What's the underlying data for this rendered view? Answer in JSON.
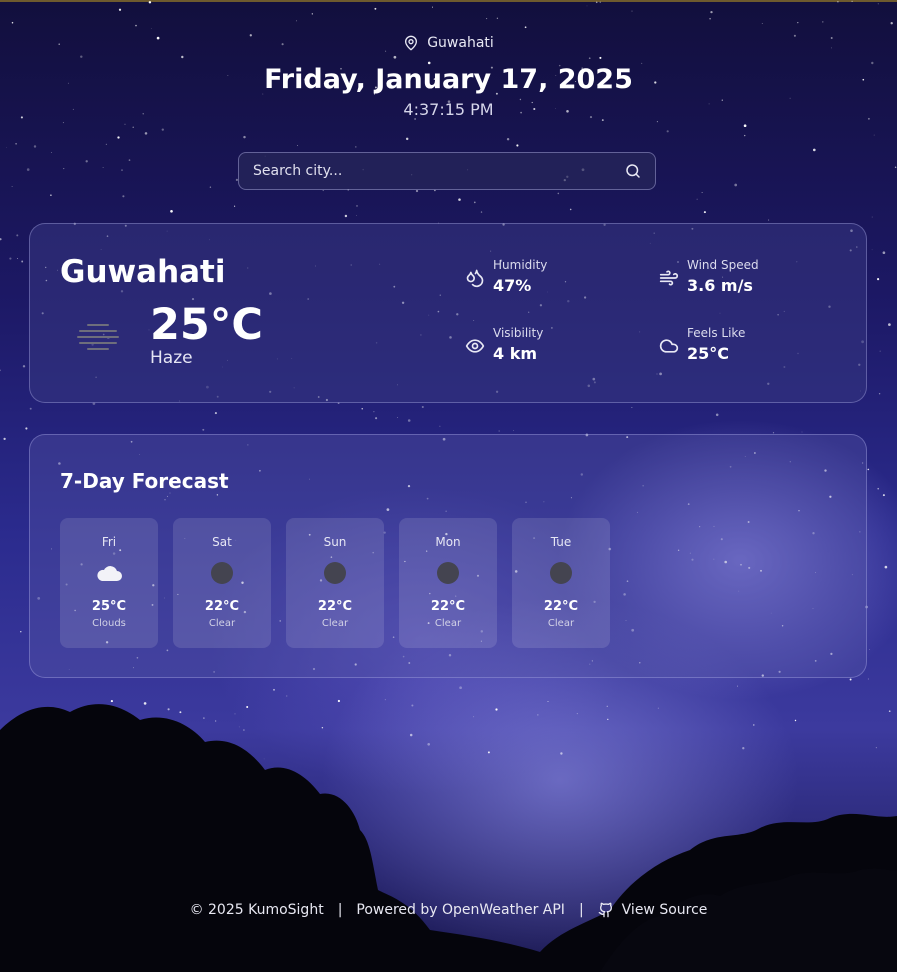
{
  "header": {
    "location": "Guwahati",
    "date": "Friday, January 17, 2025",
    "time": "4:37:15 PM"
  },
  "search": {
    "placeholder": "Search city..."
  },
  "current": {
    "city": "Guwahati",
    "temperature": "25°C",
    "condition": "Haze",
    "condition_icon": "haze-icon",
    "stats": [
      {
        "label": "Humidity",
        "value": "47%",
        "icon": "droplets-icon"
      },
      {
        "label": "Wind Speed",
        "value": "3.6 m/s",
        "icon": "wind-icon"
      },
      {
        "label": "Visibility",
        "value": "4 km",
        "icon": "eye-icon"
      },
      {
        "label": "Feels Like",
        "value": "25°C",
        "icon": "cloud-icon"
      }
    ]
  },
  "forecast": {
    "title": "7-Day Forecast",
    "days": [
      {
        "day": "Fri",
        "temp": "25°C",
        "desc": "Clouds",
        "icon": "clouds-icon"
      },
      {
        "day": "Sat",
        "temp": "22°C",
        "desc": "Clear",
        "icon": "clear-icon"
      },
      {
        "day": "Sun",
        "temp": "22°C",
        "desc": "Clear",
        "icon": "clear-icon"
      },
      {
        "day": "Mon",
        "temp": "22°C",
        "desc": "Clear",
        "icon": "clear-icon"
      },
      {
        "day": "Tue",
        "temp": "22°C",
        "desc": "Clear",
        "icon": "clear-icon"
      }
    ]
  },
  "footer": {
    "copyright": "© 2025 KumoSight",
    "separator": "|",
    "powered": "Powered by OpenWeather API",
    "source": "View Source"
  }
}
